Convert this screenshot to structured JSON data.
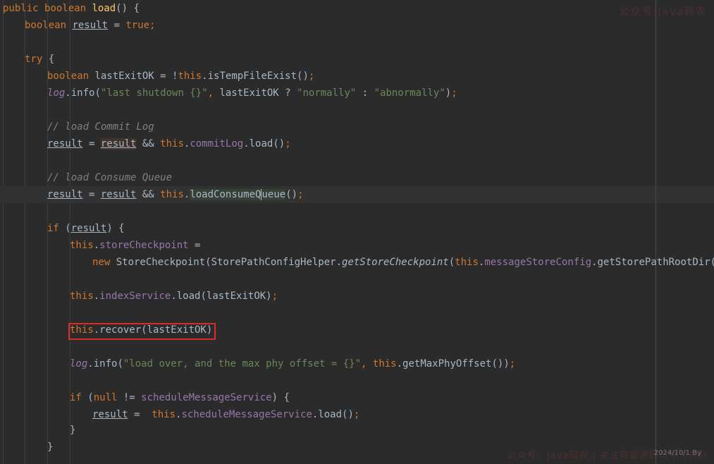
{
  "editor": {
    "language": "Java",
    "theme_background": "#2b2b2b",
    "highlight_box_color": "#d92b2b",
    "lines": [
      [
        [
          "kw",
          "public "
        ],
        [
          "kw",
          "boolean "
        ],
        [
          "method",
          "load"
        ],
        [
          "plain",
          "() {"
        ]
      ],
      [
        [
          "kw",
          "boolean "
        ],
        [
          "varu",
          "result"
        ],
        [
          "plain",
          " = "
        ],
        [
          "kw",
          "true"
        ],
        [
          "kw",
          ";"
        ]
      ],
      [],
      [
        [
          "kw",
          "try "
        ],
        [
          "plain",
          "{"
        ]
      ],
      [
        [
          "kw",
          "boolean "
        ],
        [
          "plain",
          "lastExitOK = !"
        ],
        [
          "kw",
          "this"
        ],
        [
          "plain",
          "."
        ],
        [
          "plain",
          "isTempFileExist"
        ],
        [
          "plain",
          "()"
        ],
        [
          "kw",
          ";"
        ]
      ],
      [
        [
          "field-i",
          "log"
        ],
        [
          "plain",
          ".info("
        ],
        [
          "str",
          "\"last shutdown {}\""
        ],
        [
          "kw",
          ", "
        ],
        [
          "plain",
          "lastExitOK ? "
        ],
        [
          "str",
          "\"normally\""
        ],
        [
          "plain",
          " : "
        ],
        [
          "str",
          "\"abnormally\""
        ],
        [
          "plain",
          ")"
        ],
        [
          "kw",
          ";"
        ]
      ],
      [],
      [
        [
          "comment",
          "// load Commit Log"
        ]
      ],
      [
        [
          "varu",
          "result"
        ],
        [
          "plain",
          " = "
        ],
        [
          "hlwrite",
          "result"
        ],
        [
          "plain",
          " && "
        ],
        [
          "kw",
          "this"
        ],
        [
          "plain",
          "."
        ],
        [
          "field",
          "commitLog"
        ],
        [
          "plain",
          ".load()"
        ],
        [
          "kw",
          ";"
        ]
      ],
      [],
      [
        [
          "comment",
          "// load Consume Queue"
        ]
      ],
      [
        [
          "varu",
          "result"
        ],
        [
          "plain",
          " = "
        ],
        [
          "varu",
          "result"
        ],
        [
          "plain",
          " && "
        ],
        [
          "kw",
          "this"
        ],
        [
          "plain",
          "."
        ],
        [
          "hlread",
          "loadConsumeQ"
        ],
        [
          "caret",
          ""
        ],
        [
          "hlread",
          "ueue"
        ],
        [
          "plain",
          "()"
        ],
        [
          "kw",
          ";"
        ]
      ],
      [],
      [
        [
          "kw",
          "if "
        ],
        [
          "plain",
          "("
        ],
        [
          "varu",
          "result"
        ],
        [
          "plain",
          ") {"
        ]
      ],
      [
        [
          "kw",
          "this"
        ],
        [
          "plain",
          "."
        ],
        [
          "field",
          "storeCheckpoint"
        ],
        [
          "plain",
          " ="
        ]
      ],
      [
        [
          "kw",
          "new "
        ],
        [
          "plain",
          "StoreCheckpoint(StorePathConfigHelper."
        ],
        [
          "static",
          "getStoreCheckpoint"
        ],
        [
          "plain",
          "("
        ],
        [
          "kw",
          "this"
        ],
        [
          "plain",
          "."
        ],
        [
          "field",
          "messageStoreConfig"
        ],
        [
          "plain",
          ".getStorePathRootDir()))"
        ],
        [
          "kw",
          ";"
        ]
      ],
      [],
      [
        [
          "kw",
          "this"
        ],
        [
          "plain",
          "."
        ],
        [
          "field",
          "indexService"
        ],
        [
          "plain",
          ".load(lastExitOK)"
        ],
        [
          "kw",
          ";"
        ]
      ],
      [],
      [
        [
          "kw",
          "this"
        ],
        [
          "plain",
          ".recover(lastExitOK)"
        ],
        [
          "kw",
          ";"
        ]
      ],
      [],
      [
        [
          "field-i",
          "log"
        ],
        [
          "plain",
          ".info("
        ],
        [
          "str",
          "\"load over, and the max phy offset = {}\""
        ],
        [
          "kw",
          ", "
        ],
        [
          "kw",
          "this"
        ],
        [
          "plain",
          ".getMaxPhyOffset())"
        ],
        [
          "kw",
          ";"
        ]
      ],
      [],
      [
        [
          "kw",
          "if "
        ],
        [
          "plain",
          "("
        ],
        [
          "kw",
          "null"
        ],
        [
          "plain",
          " != "
        ],
        [
          "field",
          "scheduleMessageService"
        ],
        [
          "plain",
          ") {"
        ]
      ],
      [
        [
          "varu",
          "result"
        ],
        [
          "plain",
          " =  "
        ],
        [
          "kw",
          "this"
        ],
        [
          "plain",
          "."
        ],
        [
          "field",
          "scheduleMessageService"
        ],
        [
          "plain",
          ".load()"
        ],
        [
          "kw",
          ";"
        ]
      ],
      [
        [
          "plain",
          "}"
        ]
      ],
      [
        [
          "plain",
          "}"
        ]
      ]
    ],
    "line_tops": [
      0,
      24,
      48,
      72,
      96,
      120,
      144,
      168,
      192,
      216,
      240,
      264,
      288,
      312,
      336,
      360,
      384,
      408,
      432,
      456,
      480,
      504,
      528,
      552,
      576,
      598,
      622
    ],
    "line_indents": [
      4,
      35,
      0,
      35,
      67,
      67,
      0,
      67,
      67,
      0,
      67,
      67,
      0,
      67,
      99,
      131,
      0,
      99,
      0,
      99,
      0,
      99,
      0,
      99,
      131,
      99,
      67
    ]
  },
  "watermark": {
    "top_text": "公众号:Java码农",
    "bottom_text": "公众号：Java码农 | 关注获取源码与学习资料",
    "small_text": "2024/10/1 By"
  }
}
